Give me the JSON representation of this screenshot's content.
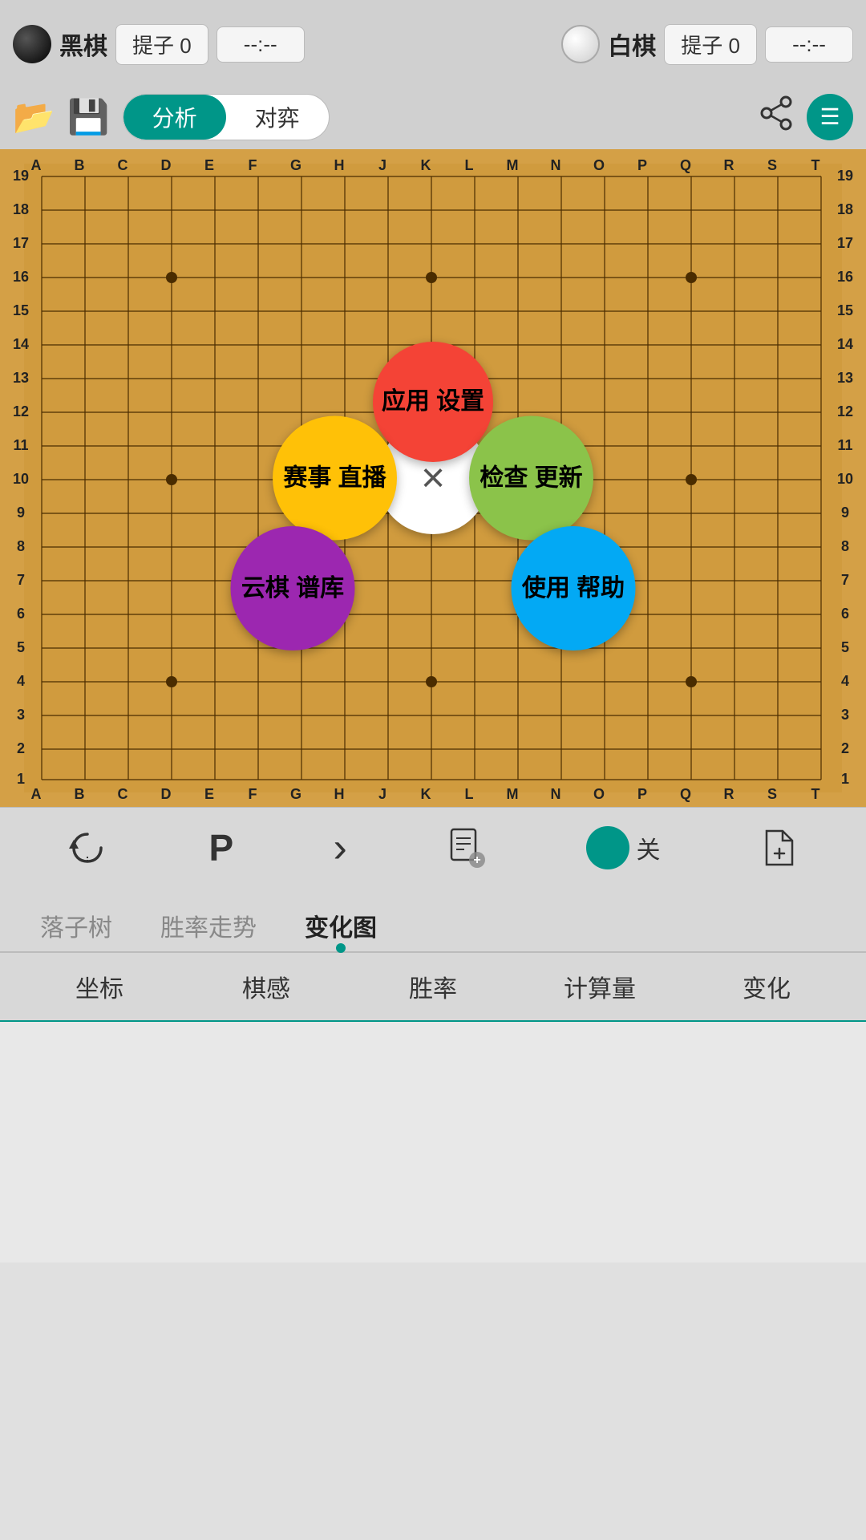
{
  "header": {
    "black_label": "黑棋",
    "black_captures_label": "提子",
    "black_captures_value": "0",
    "black_timer": "--:--",
    "white_label": "白棋",
    "white_captures_label": "提子",
    "white_captures_value": "0",
    "white_timer": "--:--"
  },
  "toolbar": {
    "mode_analyze": "分析",
    "mode_opponent": "对弈"
  },
  "board": {
    "cols": [
      "A",
      "B",
      "C",
      "D",
      "E",
      "F",
      "G",
      "H",
      "J",
      "K",
      "L",
      "M",
      "N",
      "O",
      "P",
      "Q",
      "R",
      "S",
      "T"
    ],
    "rows": [
      "19",
      "18",
      "17",
      "16",
      "15",
      "14",
      "13",
      "12",
      "11",
      "10",
      "9",
      "8",
      "7",
      "6",
      "5",
      "4",
      "3",
      "2",
      "1"
    ]
  },
  "menu": {
    "close_icon": "×",
    "settings_label": "应用\n设置",
    "broadcast_label": "赛事\n直播",
    "check_update_label": "检查\n更新",
    "cloud_library_label": "云棋\n谱库",
    "help_label": "使用\n帮助"
  },
  "controls": {
    "toggle_label": "关",
    "tabs": [
      "落子树",
      "胜率走势",
      "变化图"
    ],
    "active_tab": "变化图",
    "sub_tabs": [
      "坐标",
      "棋感",
      "胜率",
      "计算量",
      "变化"
    ]
  }
}
